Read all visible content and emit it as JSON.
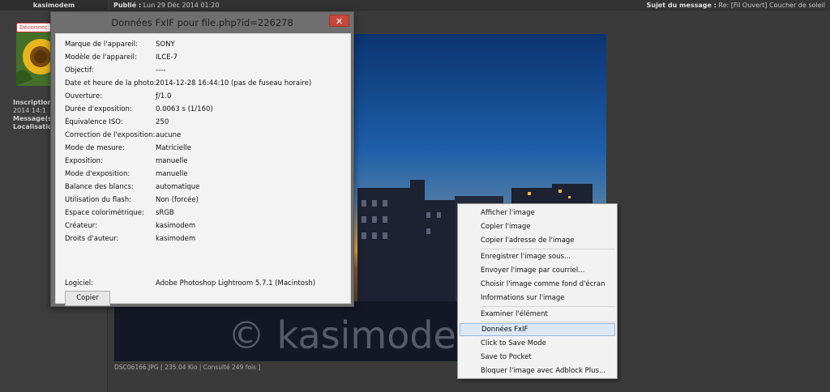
{
  "forum": {
    "username": "kasimodem",
    "disconnect_badge": "Déconnec",
    "profile": [
      {
        "label": "Inscription",
        "value": ""
      },
      {
        "label": "",
        "value": "2014 14:1"
      },
      {
        "label": "Message(s",
        "value": ""
      },
      {
        "label": "Localisatio",
        "value": ""
      }
    ],
    "post_published_label": "Publié :",
    "post_published_value": "Lun 29 Déc 2014 01:20",
    "post_subject_label": "Sujet du message :",
    "post_subject_value": "Re: [Fil Ouvert] Coucher de soleil",
    "watermark": "© kasimode",
    "photo_caption": "DSC06166.JPG [ 235.04 Kio | Consulté 249 fois ]"
  },
  "exif_dialog": {
    "title": "Données FxIF pour file.php?id=226278",
    "close_symbol": "✕",
    "rows": [
      {
        "label": "Marque de l'appareil:",
        "value": "SONY"
      },
      {
        "label": "Modèle de l'appareil:",
        "value": "ILCE-7"
      },
      {
        "label": "Objectif:",
        "value": "----"
      },
      {
        "label": "Date et heure de la photo:",
        "value": "2014-12-28 16:44:10 (pas de fuseau horaire)"
      },
      {
        "label": "Ouverture:",
        "value": "ƒ/1.0"
      },
      {
        "label": "Durée d'exposition:",
        "value": "0.0063 s (1/160)"
      },
      {
        "label": "Équivalence ISO:",
        "value": "250"
      },
      {
        "label": "Correction de l'exposition:",
        "value": "aucune"
      },
      {
        "label": "Mode de mesure:",
        "value": "Matricielle"
      },
      {
        "label": "Exposition:",
        "value": "manuelle"
      },
      {
        "label": "Mode d'exposition:",
        "value": "manuelle"
      },
      {
        "label": "Balance des blancs:",
        "value": "automatique"
      },
      {
        "label": "Utilisation du flash:",
        "value": "Non (forcée)"
      },
      {
        "label": "Espace colorimétrique:",
        "value": "sRGB"
      },
      {
        "label": "Créateur:",
        "value": "kasimodem"
      },
      {
        "label": "Droits d'auteur:",
        "value": "kasimodem"
      }
    ],
    "software_label": "Logiciel:",
    "software_value": "Adobe Photoshop Lightroom 5.7.1 (Macintosh)",
    "copy_button": "Copier"
  },
  "context_menu": {
    "items": [
      {
        "label": "Afficher l'image"
      },
      {
        "label": "Copier l'image"
      },
      {
        "label": "Copier l'adresse de l'image"
      },
      {
        "label": "Enregistrer l'image sous..."
      },
      {
        "label": "Envoyer l'image par courriel..."
      },
      {
        "label": "Choisir l'image comme fond d'écran"
      },
      {
        "label": "Informations sur l'image"
      },
      {
        "label": "Examiner l'élément"
      },
      {
        "label": "Données FxIF"
      },
      {
        "label": "Click to Save Mode"
      },
      {
        "label": "Save to Pocket"
      },
      {
        "label": "Bloquer l'image avec Adblock Plus..."
      }
    ]
  }
}
